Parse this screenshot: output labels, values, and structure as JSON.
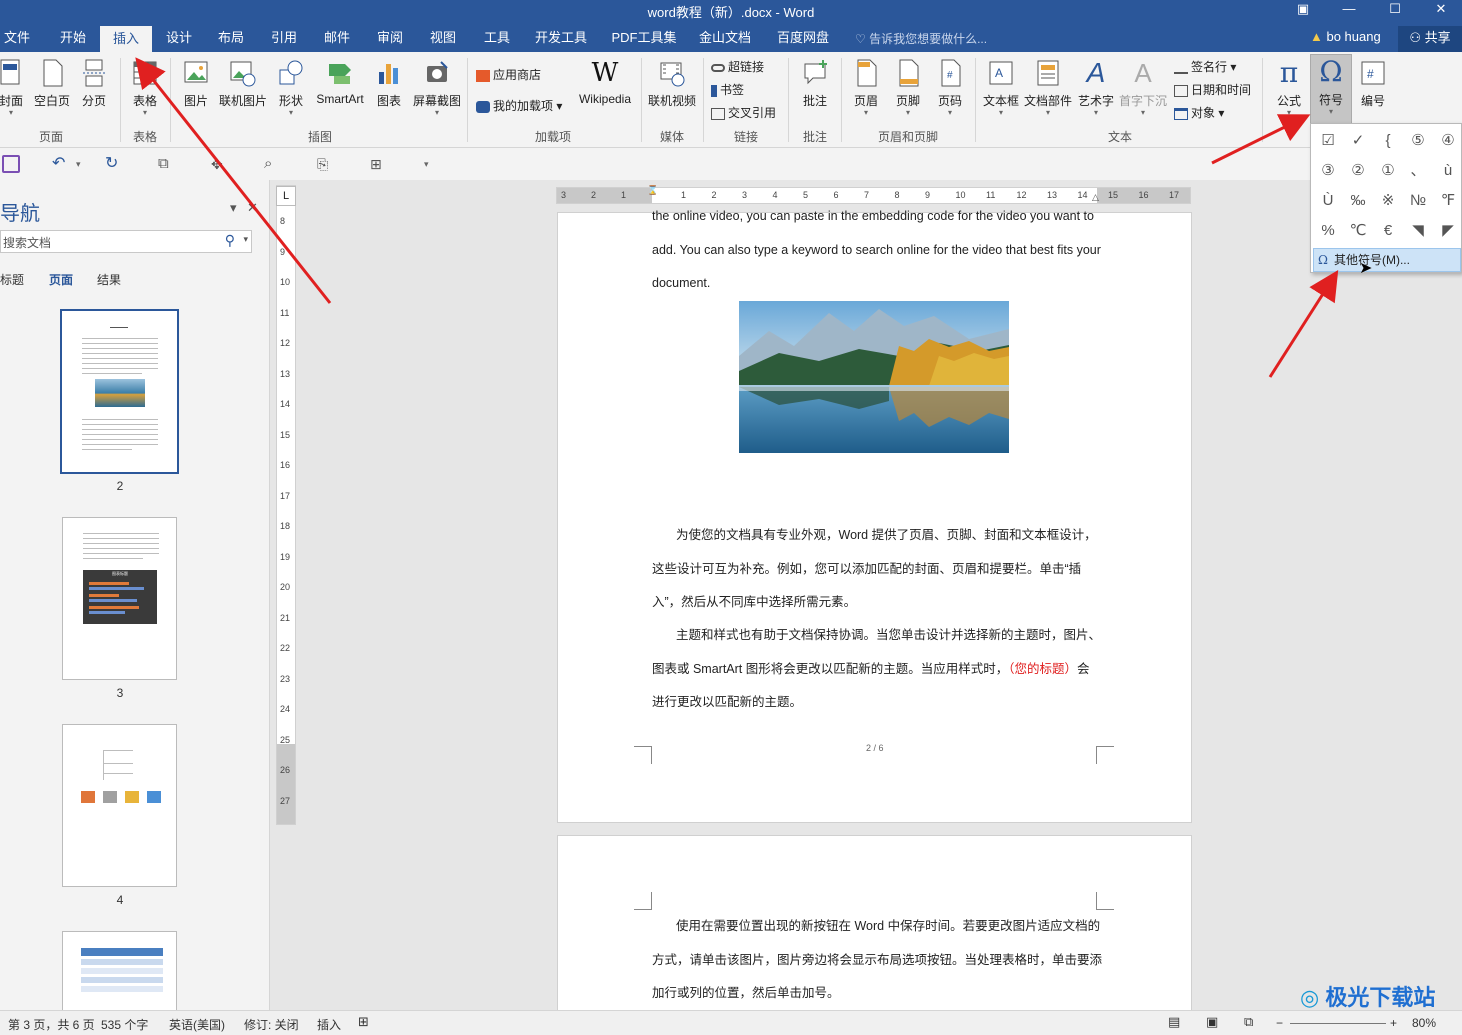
{
  "window": {
    "title": "word教程（新）.docx - Word"
  },
  "tabs": [
    "文件",
    "开始",
    "插入",
    "设计",
    "布局",
    "引用",
    "邮件",
    "审阅",
    "视图",
    "工具",
    "开发工具",
    "PDF工具集",
    "金山文档",
    "百度网盘"
  ],
  "tell_me": "告诉我您想要做什么...",
  "user": "bo huang",
  "share": "共享",
  "ribbon": {
    "cover": "封面",
    "blank": "空白页",
    "break": "分页",
    "group_pages": "页面",
    "table": "表格",
    "group_tables": "表格",
    "picture": "图片",
    "online_picture": "联机图片",
    "shapes": "形状",
    "smartart": "SmartArt",
    "chart": "图表",
    "screenshot": "屏幕截图",
    "group_illustrations": "插图",
    "store": "应用商店",
    "my_addins": "我的加载项",
    "wikipedia": "Wikipedia",
    "group_addins": "加载项",
    "online_video": "联机视频",
    "group_media": "媒体",
    "hyperlink": "超链接",
    "bookmark": "书签",
    "crossref": "交叉引用",
    "group_links": "链接",
    "comment": "批注",
    "group_comments": "批注",
    "header": "页眉",
    "footer": "页脚",
    "page_number": "页码",
    "group_header_footer": "页眉和页脚",
    "textbox": "文本框",
    "quick_parts": "文档部件",
    "wordart": "艺术字",
    "dropcap": "首字下沉",
    "signature": "签名行",
    "datetime": "日期和时间",
    "object": "对象",
    "group_text": "文本",
    "equation": "公式",
    "symbol": "符号",
    "numbering": "编号"
  },
  "symbols": [
    "☑",
    "✓",
    "{",
    "⑤",
    "④",
    "③",
    "②",
    "①",
    "、",
    "ù",
    "Ù",
    "‰",
    "※",
    "№",
    "℉",
    "%",
    "℃",
    "€",
    "◥",
    "◤"
  ],
  "more_symbols": "其他符号(M)...",
  "nav": {
    "title": "导航",
    "search_placeholder": "搜索文档",
    "tabs": [
      "标题",
      "页面",
      "结果"
    ],
    "page_numbers": [
      "2",
      "3",
      "4"
    ],
    "thumb3_chart_title": "图表标题"
  },
  "ruler": {
    "h_ticks": [
      "3",
      "2",
      "1",
      "1",
      "2",
      "3",
      "4",
      "5",
      "6",
      "7",
      "8",
      "9",
      "10",
      "11",
      "12",
      "13",
      "14",
      "15",
      "16",
      "17"
    ],
    "v_ticks": [
      "8",
      "9",
      "10",
      "11",
      "12",
      "13",
      "14",
      "15",
      "16",
      "17",
      "18",
      "19",
      "20",
      "21",
      "22",
      "23",
      "24",
      "25",
      "26",
      "27"
    ]
  },
  "document": {
    "p1": "the online video, you can paste in the embedding code for the video you want to add. You can also type a keyword to search online for the video that best fits your document.",
    "p2": "为使您的文档具有专业外观，Word 提供了页眉、页脚、封面和文本框设计，这些设计可互为补充。例如，您可以添加匹配的封面、页眉和提要栏。单击“插入”，然后从不同库中选择所需元素。",
    "p3_a": "主题和样式也有助于文档保持协调。当您单击设计并选择新的主题时，图片、图表或 SmartArt 图形将会更改以匹配新的主题。当应用样式时，",
    "p3_red": "（您的标题）",
    "p3_b": "会进行更改以匹配新的主题。",
    "page_number": "2 / 6",
    "p4": "使用在需要位置出现的新按钮在 Word 中保存时间。若要更改图片适应文档的方式，请单击该图片，图片旁边将会显示布局选项按钮。当处理表格时，单击要添加行或列的位置，然后单击加号。"
  },
  "status": {
    "page": "第 3 页，共 6 页",
    "words": "535 个字",
    "language": "英语(美国)",
    "track": "修订: 关闭",
    "mode": "插入",
    "zoom": "80%"
  },
  "watermark": "极光下载站",
  "colors": {
    "brand": "#2b579a",
    "arrow": "#e02020",
    "highlight": "#cde3f7"
  }
}
